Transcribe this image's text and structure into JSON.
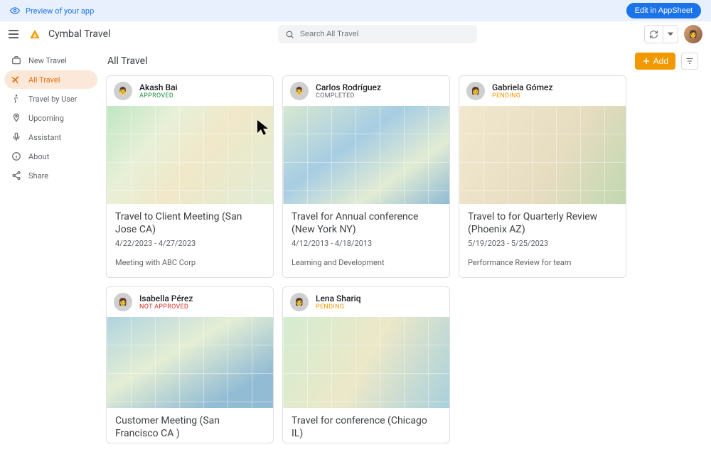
{
  "preview": {
    "label": "Preview of your app",
    "edit_button": "Edit in AppSheet"
  },
  "header": {
    "title": "Cymbal Travel",
    "search_placeholder": "Search All Travel"
  },
  "sidebar": {
    "items": [
      {
        "label": "New Travel",
        "icon": "briefcase"
      },
      {
        "label": "All Travel",
        "icon": "plane",
        "active": true
      },
      {
        "label": "Travel by User",
        "icon": "walker"
      },
      {
        "label": "Upcoming",
        "icon": "pin"
      },
      {
        "label": "Assistant",
        "icon": "mic"
      },
      {
        "label": "About",
        "icon": "info"
      },
      {
        "label": "Share",
        "icon": "share"
      }
    ]
  },
  "main": {
    "title": "All Travel",
    "add_label": "Add"
  },
  "cards": [
    {
      "person": "Akash Bai",
      "status": "APPROVED",
      "status_class": "st-approved",
      "title": "Travel to Client Meeting (San Jose CA)",
      "dates": "4/22/2023 - 4/27/2023",
      "desc": "Meeting with ABC Corp",
      "map": "m1"
    },
    {
      "person": "Carlos Rodríguez",
      "status": "COMPLETED",
      "status_class": "st-completed",
      "title": "Travel for Annual conference (New York NY)",
      "dates": "4/12/2013 - 4/18/2013",
      "desc": "Learning and Development",
      "map": "m2"
    },
    {
      "person": "Gabriela Gómez",
      "status": "PENDING",
      "status_class": "st-pending",
      "title": "Travel to for Quarterly Review (Phoenix AZ)",
      "dates": "5/19/2023 - 5/25/2023",
      "desc": "Performance Review for team",
      "map": "m3"
    },
    {
      "person": "Isabella Pérez",
      "status": "NOT APPROVED",
      "status_class": "st-notapproved",
      "title": "Customer Meeting (San Francisco CA )",
      "dates": "",
      "desc": "",
      "map": "m4"
    },
    {
      "person": "Lena Shariq",
      "status": "PENDING",
      "status_class": "st-pending",
      "title": "Travel for conference (Chicago IL)",
      "dates": "",
      "desc": "",
      "map": "m5"
    }
  ]
}
